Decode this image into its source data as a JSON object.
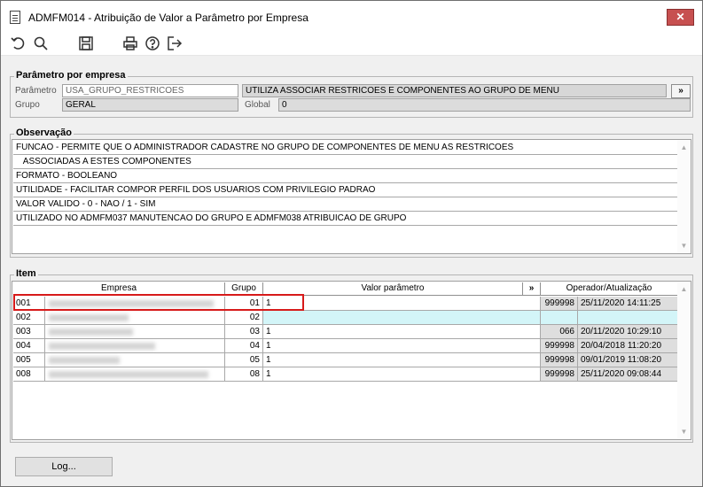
{
  "window": {
    "title": "ADMFM014 - Atribuição de Valor a Parâmetro por Empresa",
    "close_label": "✕"
  },
  "toolbar": {
    "icons": [
      "undo-icon",
      "search-icon",
      "save-icon",
      "print-icon",
      "help-icon",
      "exit-icon"
    ]
  },
  "parametro": {
    "legend": "Parâmetro por empresa",
    "parametro_label": "Parâmetro",
    "parametro_value": "USA_GRUPO_RESTRICOES",
    "descricao_value": "UTILIZA ASSOCIAR RESTRICOES E COMPONENTES AO GRUPO DE MENU",
    "more_label": "»",
    "grupo_label": "Grupo",
    "grupo_value": "GERAL",
    "global_label": "Global",
    "global_value": "0"
  },
  "observacao": {
    "legend": "Observação",
    "lines": [
      "FUNCAO - PERMITE QUE O ADMINISTRADOR CADASTRE NO GRUPO DE COMPONENTES DE MENU AS RESTRICOES",
      "   ASSOCIADAS A ESTES COMPONENTES",
      "FORMATO - BOOLEANO",
      "UTILIDADE - FACILITAR COMPOR PERFIL DOS USUARIOS COM PRIVILEGIO PADRAO",
      "VALOR VALIDO - 0 - NAO / 1 - SIM",
      "UTILIZADO NO ADMFM037 MANUTENCAO DO GRUPO E ADMFM038 ATRIBUICAO DE GRUPO"
    ]
  },
  "item": {
    "legend": "Item",
    "headers": {
      "empresa": "Empresa",
      "grupo": "Grupo",
      "valor": "Valor parâmetro",
      "more": "»",
      "operador": "Operador/Atualização"
    },
    "rows": [
      {
        "code": "001",
        "grupo": "01",
        "valor": "1",
        "operador": "999998",
        "data": "25/11/2020 14:11:25"
      },
      {
        "code": "002",
        "grupo": "02",
        "valor": "",
        "operador": "",
        "data": ""
      },
      {
        "code": "003",
        "grupo": "03",
        "valor": "1",
        "operador": "066",
        "data": "20/11/2020 10:29:10"
      },
      {
        "code": "004",
        "grupo": "04",
        "valor": "1",
        "operador": "999998",
        "data": "20/04/2018 11:20:20"
      },
      {
        "code": "005",
        "grupo": "05",
        "valor": "1",
        "operador": "999998",
        "data": "09/01/2019 11:08:20"
      },
      {
        "code": "008",
        "grupo": "08",
        "valor": "1",
        "operador": "999998",
        "data": "25/11/2020 09:08:44"
      }
    ]
  },
  "footer": {
    "log_label": "Log..."
  }
}
